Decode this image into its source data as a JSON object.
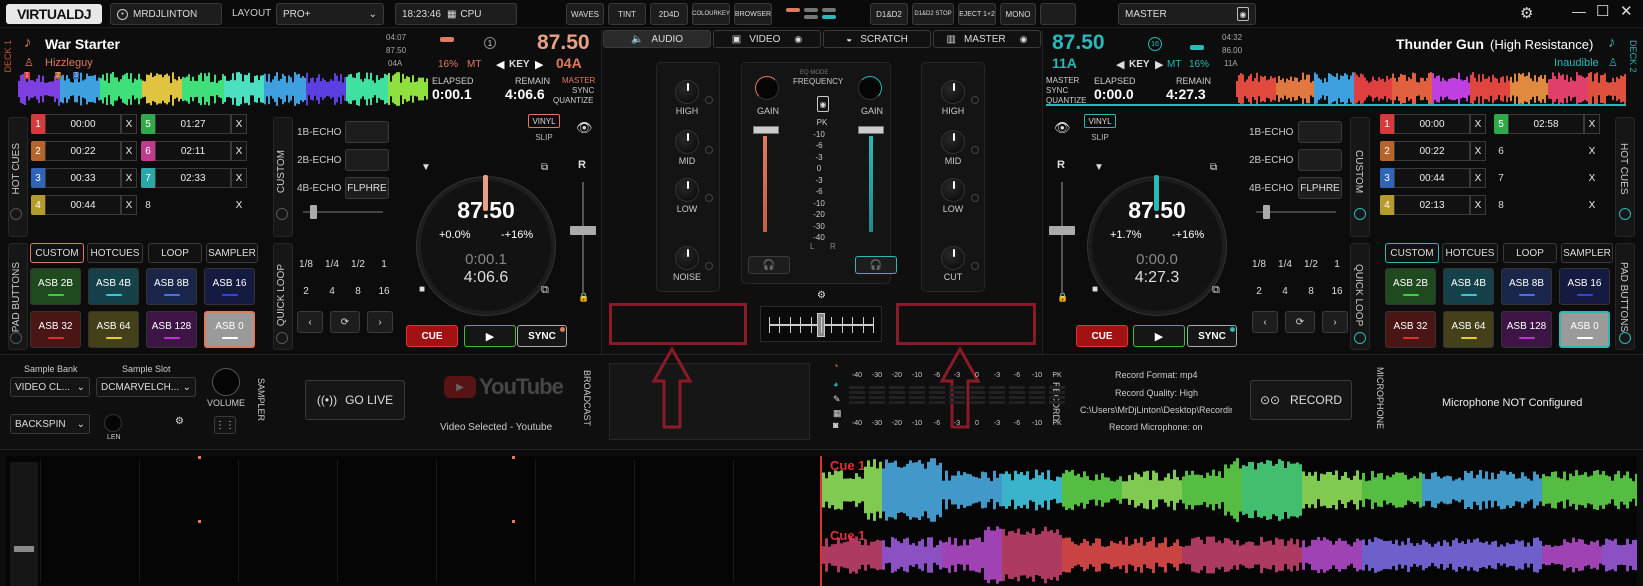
{
  "topbar": {
    "logo": "VIRTUALDJ",
    "user": "MRDJLINTON",
    "layout_label": "LAYOUT",
    "layout_value": "PRO+",
    "clock": "18:23:46",
    "cpu_label": "CPU",
    "buttons": [
      "WAVES",
      "TINT",
      "2D4D",
      "COLOURKEY",
      "BROWSER",
      "D1&D2",
      "D1&D2 STOP",
      "EJECT 1+2",
      "MONO"
    ],
    "master_label": "MASTER"
  },
  "deck1": {
    "side": "DECK 1",
    "title": "War Starter",
    "artist": "Hizzleguy",
    "bpm": "87.50",
    "key_label": "KEY",
    "key": "04A",
    "mini_time1": "04:07",
    "mini_bpm": "87.50",
    "mini_key": "04A",
    "pitch_pct": "16%",
    "mt": "MT",
    "elapsed_label": "ELAPSED",
    "elapsed": "0:00.1",
    "remain_label": "REMAIN",
    "remain": "4:06.6",
    "master": "MASTER",
    "sync": "SYNC",
    "quantize": "QUANTIZE",
    "vinyl": "VINYL",
    "slip": "SLIP",
    "jog_bpm": "87.50",
    "jog_left": "+0.0%",
    "jog_right": "-+16%",
    "jog_elapsed": "0:00.1",
    "jog_remain": "4:06.6",
    "r": "R",
    "cue": "CUE",
    "play": "▶",
    "sync_btn": "SYNC",
    "hot_cues_label": "HOT CUES",
    "custom_label": "CUSTOM",
    "quick_loop_label": "QUICK LOOP",
    "pad_buttons_label": "PAD BUTTONS",
    "cues": [
      {
        "n": "1",
        "t": "00:00",
        "c": "#d63a3a"
      },
      {
        "n": "2",
        "t": "00:22",
        "c": "#b5652c"
      },
      {
        "n": "3",
        "t": "00:33",
        "c": "#2f64b8"
      },
      {
        "n": "4",
        "t": "00:44",
        "c": "#b59a2c"
      },
      {
        "n": "5",
        "t": "01:27",
        "c": "#2faa4b"
      },
      {
        "n": "6",
        "t": "02:11",
        "c": "#c03c8f"
      },
      {
        "n": "7",
        "t": "02:33",
        "c": "#2aa7a7"
      },
      {
        "n": "8",
        "t": "",
        "c": ""
      }
    ],
    "echo": [
      "1B-ECHO",
      "2B-ECHO",
      "4B-ECHO"
    ],
    "flp": "FLPHRE",
    "loops": [
      "1/8",
      "1/4",
      "1/2",
      "1",
      "2",
      "4",
      "8",
      "16"
    ],
    "pad_tabs": [
      "CUSTOM",
      "HOTCUES",
      "LOOP",
      "SAMPLER"
    ],
    "pads": [
      {
        "l": "ASB 2B",
        "bg": "#1f4a1f",
        "bar": "#3cd23c"
      },
      {
        "l": "ASB 4B",
        "bg": "#15414a",
        "bar": "#33c8d8"
      },
      {
        "l": "ASB 8B",
        "bg": "#19264a",
        "bar": "#4a6ef0"
      },
      {
        "l": "ASB 16",
        "bg": "#151a40",
        "bar": "#3344dd"
      },
      {
        "l": "ASB 32",
        "bg": "#4a1515",
        "bar": "#e03030"
      },
      {
        "l": "ASB 64",
        "bg": "#44401a",
        "bar": "#e0d030"
      },
      {
        "l": "ASB 128",
        "bg": "#3d1544",
        "bar": "#c030d8"
      },
      {
        "l": "ASB 0",
        "bg": "#9a9a9a",
        "bar": "#ffffff"
      }
    ]
  },
  "deck2": {
    "side": "DECK 2",
    "title": "Thunder Gun",
    "subtitle": "(High Resistance)",
    "artist": "Inaudible",
    "bpm": "87.50",
    "key_label": "KEY",
    "key": "11A",
    "mini_time1": "04:32",
    "mini_bpm": "86.00",
    "mini_key": "11A",
    "pitch_pct": "16%",
    "mt": "MT",
    "elapsed_label": "ELAPSED",
    "elapsed": "0:00.0",
    "remain_label": "REMAIN",
    "remain": "4:27.3",
    "master": "MASTER",
    "sync": "SYNC",
    "quantize": "QUANTIZE",
    "vinyl": "VINYL",
    "slip": "SLIP",
    "jog_bpm": "87.50",
    "jog_left": "+1.7%",
    "jog_right": "-+16%",
    "jog_elapsed": "0:00.0",
    "jog_remain": "4:27.3",
    "r": "R",
    "cue": "CUE",
    "play": "▶",
    "sync_btn": "SYNC",
    "hot_cues_label": "HOT CUES",
    "custom_label": "CUSTOM",
    "quick_loop_label": "QUICK LOOP",
    "pad_buttons_label": "PAD BUTTONS",
    "ring": "16",
    "cues": [
      {
        "n": "1",
        "t": "00:00",
        "c": "#d63a3a"
      },
      {
        "n": "2",
        "t": "00:22",
        "c": "#b5652c"
      },
      {
        "n": "3",
        "t": "00:44",
        "c": "#2f64b8"
      },
      {
        "n": "4",
        "t": "02:13",
        "c": "#b59a2c"
      },
      {
        "n": "5",
        "t": "02:58",
        "c": "#2faa4b"
      },
      {
        "n": "6",
        "t": "",
        "c": ""
      },
      {
        "n": "7",
        "t": "",
        "c": ""
      },
      {
        "n": "8",
        "t": "",
        "c": ""
      }
    ],
    "echo": [
      "1B-ECHO",
      "2B-ECHO",
      "4B-ECHO"
    ],
    "flp": "FLPHRE",
    "loops": [
      "1/8",
      "1/4",
      "1/2",
      "1",
      "2",
      "4",
      "8",
      "16"
    ],
    "pad_tabs": [
      "CUSTOM",
      "HOTCUES",
      "LOOP",
      "SAMPLER"
    ],
    "pads": [
      {
        "l": "ASB 2B",
        "bg": "#1f4a1f",
        "bar": "#3cd23c"
      },
      {
        "l": "ASB 4B",
        "bg": "#15414a",
        "bar": "#33c8d8"
      },
      {
        "l": "ASB 8B",
        "bg": "#19264a",
        "bar": "#4a6ef0"
      },
      {
        "l": "ASB 16",
        "bg": "#151a40",
        "bar": "#3344dd"
      },
      {
        "l": "ASB 32",
        "bg": "#4a1515",
        "bar": "#e03030"
      },
      {
        "l": "ASB 64",
        "bg": "#44401a",
        "bar": "#e0d030"
      },
      {
        "l": "ASB 128",
        "bg": "#3d1544",
        "bar": "#c030d8"
      },
      {
        "l": "ASB 0",
        "bg": "#9a9a9a",
        "bar": "#ffffff"
      }
    ]
  },
  "mixer": {
    "tabs": [
      "AUDIO",
      "VIDEO",
      "SCRATCH",
      "MASTER"
    ],
    "eq_left": [
      "HIGH",
      "MID",
      "LOW",
      "NOISE"
    ],
    "eq_right": [
      "HIGH",
      "MID",
      "LOW",
      "CUT"
    ],
    "gain": "GAIN",
    "eq_mode": "EQ MODE",
    "frequency": "FREQUENCY",
    "vu": [
      "PK",
      "-10",
      "-6",
      "-3",
      "0",
      "-3",
      "-6",
      "-10",
      "-20",
      "-30",
      "-40"
    ],
    "l": "L",
    "r": "R"
  },
  "bottom": {
    "sample_bank": "Sample Bank",
    "sample_slot": "Sample Slot",
    "bank_value": "VIDEO CL...",
    "slot_value": "DCMARVELCH...",
    "backspin": "BACKSPIN",
    "volume": "VOLUME",
    "len": "LEN",
    "sampler": "SAMPLER",
    "go_live": "GO LIVE",
    "youtube": "YouTube",
    "video_selected": "Video Selected - Youtube",
    "broadcast": "BROADCAST",
    "meter_scale": [
      "-40",
      "-30",
      "-20",
      "-10",
      "-6",
      "-3",
      "0",
      "-3",
      "-6",
      "-10",
      "PK"
    ],
    "record_label": "RECORD",
    "rec_format": "Record Format: mp4",
    "rec_quality": "Record Quality: High",
    "rec_path": "C:\\Users\\MrDjLinton\\Desktop\\Recordir",
    "rec_mic": "Record Microphone: on",
    "record_btn": "RECORD",
    "microphone": "MICROPHONE",
    "mic_status": "Microphone NOT Configured"
  },
  "waves": {
    "cue1_top": "Cue 1",
    "cue1_bottom": "Cue 1"
  }
}
